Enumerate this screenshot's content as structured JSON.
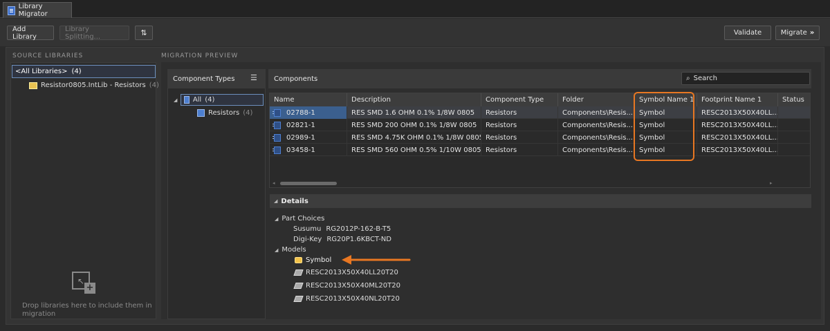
{
  "tab": {
    "label": "Library Migrator"
  },
  "toolbar": {
    "add_library": "Add Library",
    "library_splitting": "Library Splitting...",
    "validate": "Validate",
    "migrate": "Migrate"
  },
  "source": {
    "title": "SOURCE LIBRARIES",
    "all_libraries": "<All Libraries>",
    "all_count": "(4)",
    "lib_name": "Resistor0805.IntLib - Resistors",
    "lib_count": "(4)",
    "drop_hint": "Drop libraries here to include them in migration"
  },
  "preview": {
    "title": "MIGRATION PREVIEW",
    "component_types_label": "Component Types",
    "types": [
      {
        "label": "All",
        "count": "(4)"
      },
      {
        "label": "Resistors",
        "count": "(4)"
      }
    ]
  },
  "components": {
    "label": "Components",
    "search_placeholder": "Search",
    "columns": [
      "Name",
      "Description",
      "Component Type",
      "Folder",
      "Symbol Name 1",
      "Footprint Name 1",
      "Status"
    ],
    "rows": [
      {
        "name": "02788-1",
        "description": "RES SMD 1.6 OHM 0.1% 1/8W 0805",
        "type": "Resistors",
        "folder": "Components\\Resis...",
        "symbol": "Symbol",
        "footprint": "RESC2013X50X40LL...",
        "status": ""
      },
      {
        "name": "02821-1",
        "description": "RES SMD 200 OHM 0.1% 1/8W 0805",
        "type": "Resistors",
        "folder": "Components\\Resis...",
        "symbol": "Symbol",
        "footprint": "RESC2013X50X40LL...",
        "status": ""
      },
      {
        "name": "02989-1",
        "description": "RES SMD 4.75K OHM 0.1% 1/8W 0805",
        "type": "Resistors",
        "folder": "Components\\Resis...",
        "symbol": "Symbol",
        "footprint": "RESC2013X50X40LL...",
        "status": ""
      },
      {
        "name": "03458-1",
        "description": "RES SMD 560 OHM 0.5% 1/10W 0805",
        "type": "Resistors",
        "folder": "Components\\Resis...",
        "symbol": "Symbol",
        "footprint": "RESC2013X50X40LL...",
        "status": ""
      }
    ]
  },
  "details": {
    "label": "Details",
    "part_choices_label": "Part Choices",
    "part_choices": [
      {
        "supplier": "Susumu",
        "part": "RG2012P-162-B-T5"
      },
      {
        "supplier": "Digi-Key",
        "part": "RG20P1.6KBCT-ND"
      }
    ],
    "models_label": "Models",
    "models": [
      {
        "label": "Symbol",
        "icon": "symbol-icon"
      },
      {
        "label": "RESC2013X50X40LL20T20",
        "icon": "footprint-icon"
      },
      {
        "label": "RESC2013X50X40ML20T20",
        "icon": "footprint-icon"
      },
      {
        "label": "RESC2013X50X40NL20T20",
        "icon": "footprint-icon"
      }
    ]
  },
  "colors": {
    "highlight": "#e87722",
    "selection": "#3b5f8e"
  }
}
